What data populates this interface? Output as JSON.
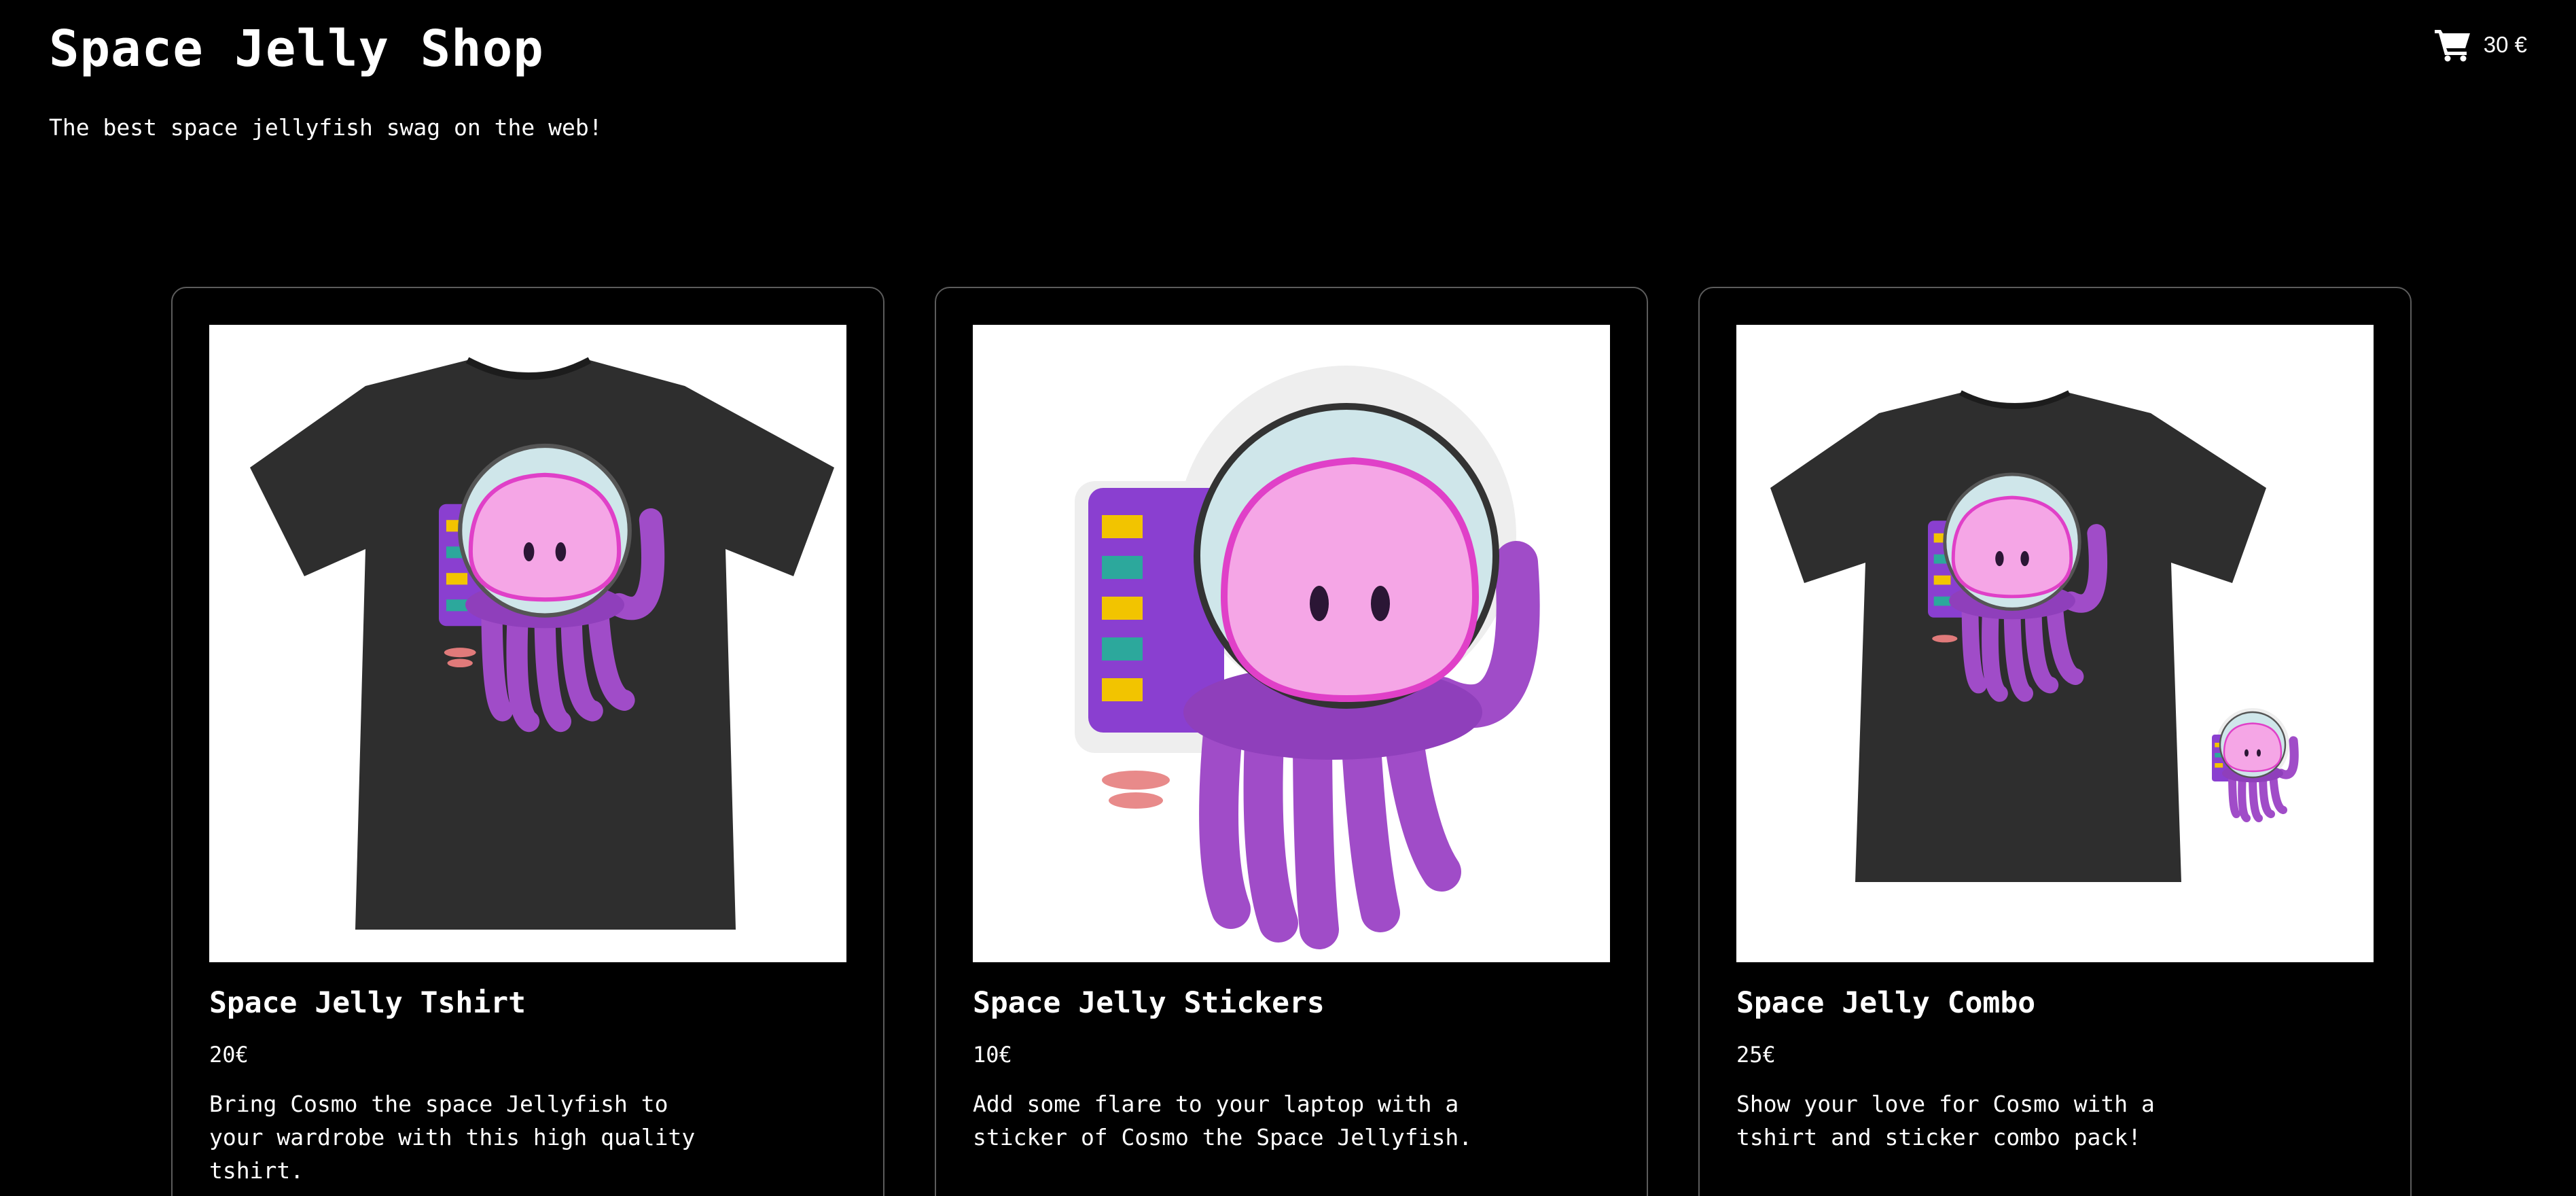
{
  "header": {
    "title": "Space Jelly Shop",
    "tagline": "The best space jellyfish swag on the web!"
  },
  "cart": {
    "icon": "shopping-cart-icon",
    "total": "30 €"
  },
  "products": [
    {
      "name": "Space Jelly Tshirt",
      "price": "20€",
      "description": "Bring Cosmo the space Jellyfish to your wardrobe with this high quality tshirt.",
      "image": "tshirt-image"
    },
    {
      "name": "Space Jelly Stickers",
      "price": "10€",
      "description": "Add some flare to your laptop with a sticker of Cosmo the Space Jellyfish.",
      "image": "sticker-image"
    },
    {
      "name": "Space Jelly Combo",
      "price": "25€",
      "description": "Show your love for Cosmo with a tshirt and sticker combo pack!",
      "image": "combo-image"
    }
  ],
  "colors": {
    "background": "#000000",
    "text": "#ffffff",
    "card_border": "#5c5c5c",
    "shirt": "#2e2e2e",
    "jelly_head": "#f5a6e6",
    "jelly_body": "#a04cc8",
    "jetpack": "#8a3fd0"
  }
}
